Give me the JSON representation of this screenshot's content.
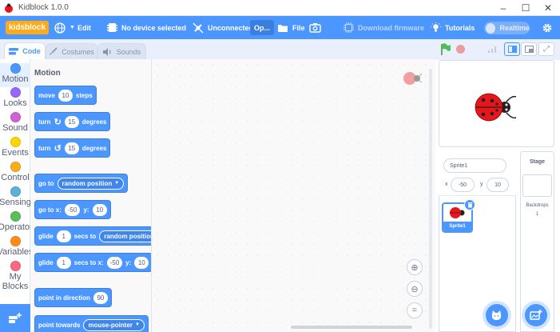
{
  "window": {
    "title": "Kidblock 1.0.0",
    "controls": [
      "minimize",
      "maximize",
      "close"
    ]
  },
  "menubar": {
    "logo": "kidsblock",
    "language_icon": "globe-icon",
    "edit": "Edit",
    "device": "No device selected",
    "connection": "Unconnected",
    "op": "Op...",
    "file": "File",
    "firmware": "Download firmware",
    "tutorials": "Tutorials",
    "realtime": "Realtime"
  },
  "tabs": [
    {
      "label": "Code",
      "active": true
    },
    {
      "label": "Costumes",
      "active": false
    },
    {
      "label": "Sounds",
      "active": false
    }
  ],
  "categories": [
    {
      "label": "Motion",
      "color": "#4c97ff"
    },
    {
      "label": "Looks",
      "color": "#9966ff"
    },
    {
      "label": "Sound",
      "color": "#cf63cf"
    },
    {
      "label": "Events",
      "color": "#ffd500"
    },
    {
      "label": "Control",
      "color": "#ffab19"
    },
    {
      "label": "Sensing",
      "color": "#5cb1d6"
    },
    {
      "label": "Operator",
      "color": "#59c059"
    },
    {
      "label": "Variables",
      "color": "#ff8c1a"
    },
    {
      "label": "My",
      "label2": "Blocks",
      "color": "#ff6680"
    }
  ],
  "palette": {
    "heading": "Motion",
    "move": {
      "pre": "move",
      "value": "10",
      "post": "steps"
    },
    "turn_right": {
      "pre": "turn",
      "value": "15",
      "post": "degrees"
    },
    "turn_left": {
      "pre": "turn",
      "value": "15",
      "post": "degrees"
    },
    "goto": {
      "pre": "go to",
      "option": "random position"
    },
    "goto_xy": {
      "pre": "go to x:",
      "x": "-50",
      "ylabel": "y:",
      "y": "10"
    },
    "glide_to": {
      "pre": "glide",
      "secs": "1",
      "mid": "secs to",
      "option": "random position"
    },
    "glide_xy": {
      "pre": "glide",
      "secs": "1",
      "mid": "secs to x:",
      "x": "-50",
      "ylabel": "y:",
      "y": "10"
    },
    "point_dir": {
      "pre": "point in direction",
      "value": "90"
    },
    "point_towards": {
      "pre": "point towards",
      "option": "mouse-pointer"
    }
  },
  "sprite": {
    "name": "Sprite1",
    "x_label": "x",
    "x": "-50",
    "y_label": "y",
    "y": "10",
    "thumb_label": "Sprite1"
  },
  "stage_panel": {
    "title": "Stage",
    "backdrops_label": "Backdrops",
    "backdrops_count": "1"
  },
  "colors": {
    "accent": "#4c97ff",
    "logo": "#ffab19",
    "ladybug": "#e8151b"
  }
}
